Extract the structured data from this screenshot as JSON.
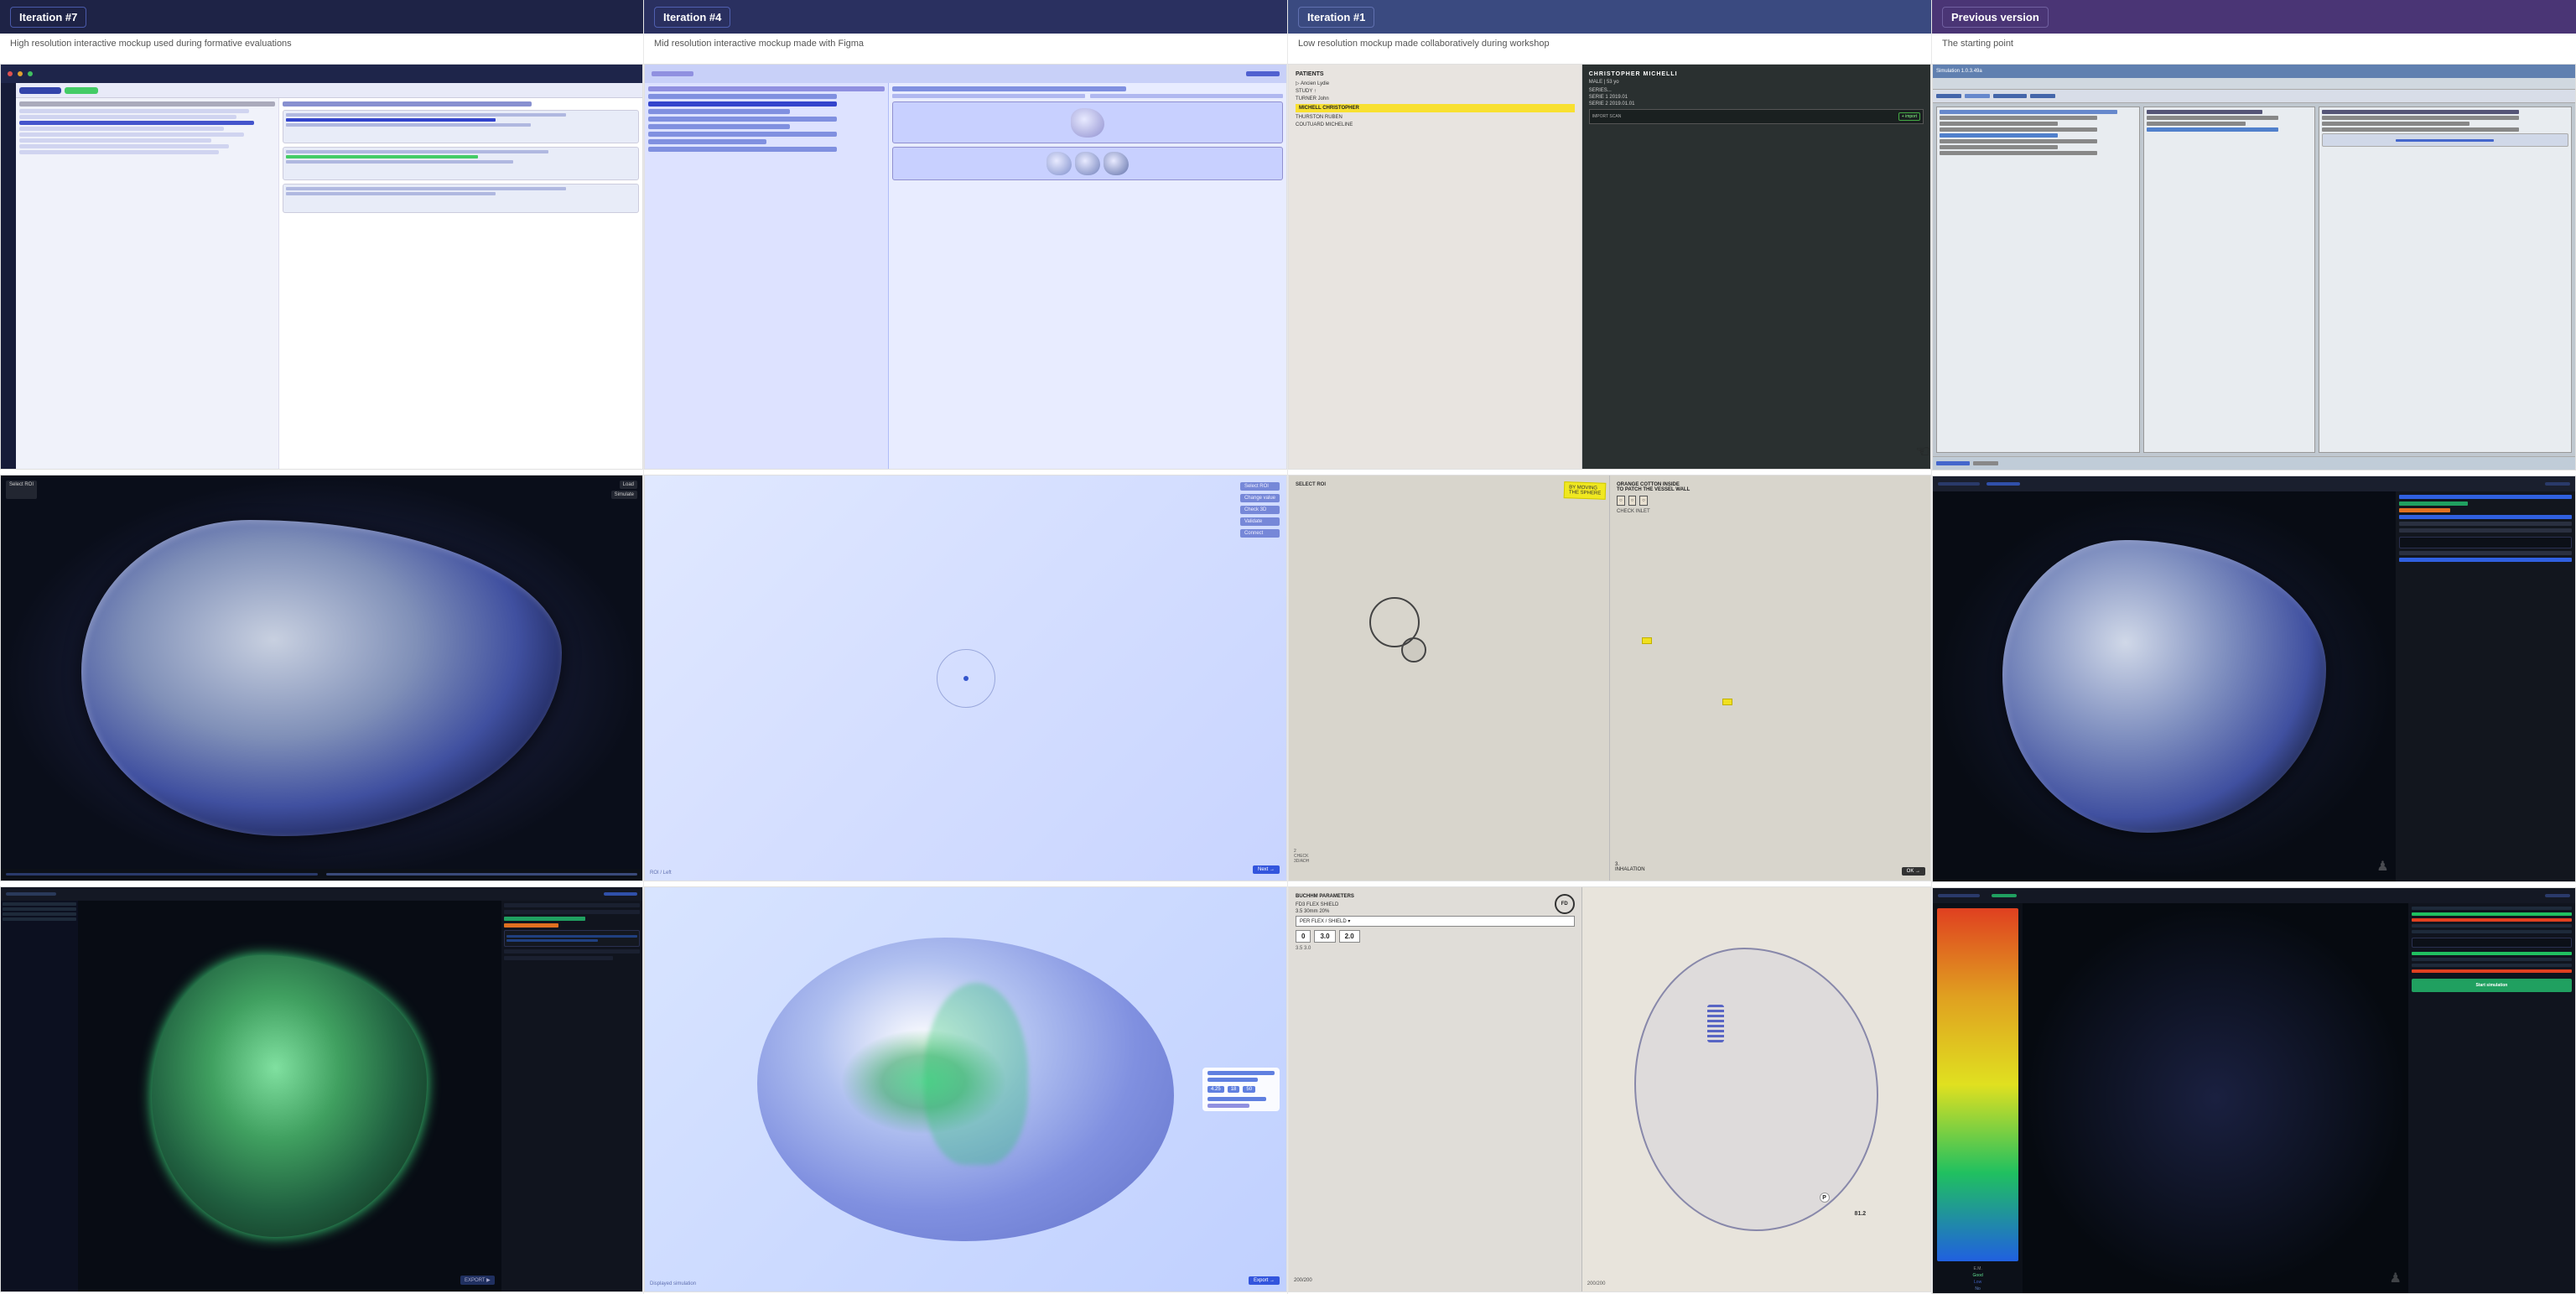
{
  "columns": [
    {
      "id": "col-7",
      "badge": "#1e2346",
      "badge_label": "Iteration #7",
      "subtitle": "High resolution interactive mockup used during formative evaluations",
      "screens": [
        {
          "type": "patients-dark",
          "label": "Patients dark mockup row 1"
        },
        {
          "type": "3d-vessel-dark",
          "label": "3D vessel dark row 2"
        },
        {
          "type": "sim-dark-color",
          "label": "Simulation dark row 3"
        }
      ]
    },
    {
      "id": "col-4",
      "badge": "#2d3875",
      "badge_label": "Iteration #4",
      "subtitle": "Mid resolution interactive mockup made with Figma",
      "screens": [
        {
          "type": "patients-figma",
          "label": "Patients figma row 1"
        },
        {
          "type": "3d-vessel-blue",
          "label": "3D vessel blue row 2"
        },
        {
          "type": "sim-blue-flow",
          "label": "Simulation blue flow row 3"
        }
      ]
    },
    {
      "id": "col-1",
      "badge": "#3a4a80",
      "badge_label": "Iteration #1",
      "subtitle": "Low resolution mockup made collaboratively during workshop",
      "screens": [
        {
          "type": "sketch-whiteboard",
          "label": "Sketch whiteboard row 1"
        },
        {
          "type": "paper-mockup",
          "label": "Paper mockup row 2"
        },
        {
          "type": "paper-sim",
          "label": "Paper simulation row 3"
        }
      ]
    },
    {
      "id": "col-prev",
      "badge": "#4a3575",
      "badge_label": "Previous version",
      "subtitle": "The starting point",
      "screens": [
        {
          "type": "old-software",
          "label": "Old software row 1"
        },
        {
          "type": "dark-3d-old",
          "label": "Dark 3D old row 2"
        },
        {
          "type": "dark-sim-colormap",
          "label": "Dark sim colormap row 3"
        }
      ]
    }
  ]
}
